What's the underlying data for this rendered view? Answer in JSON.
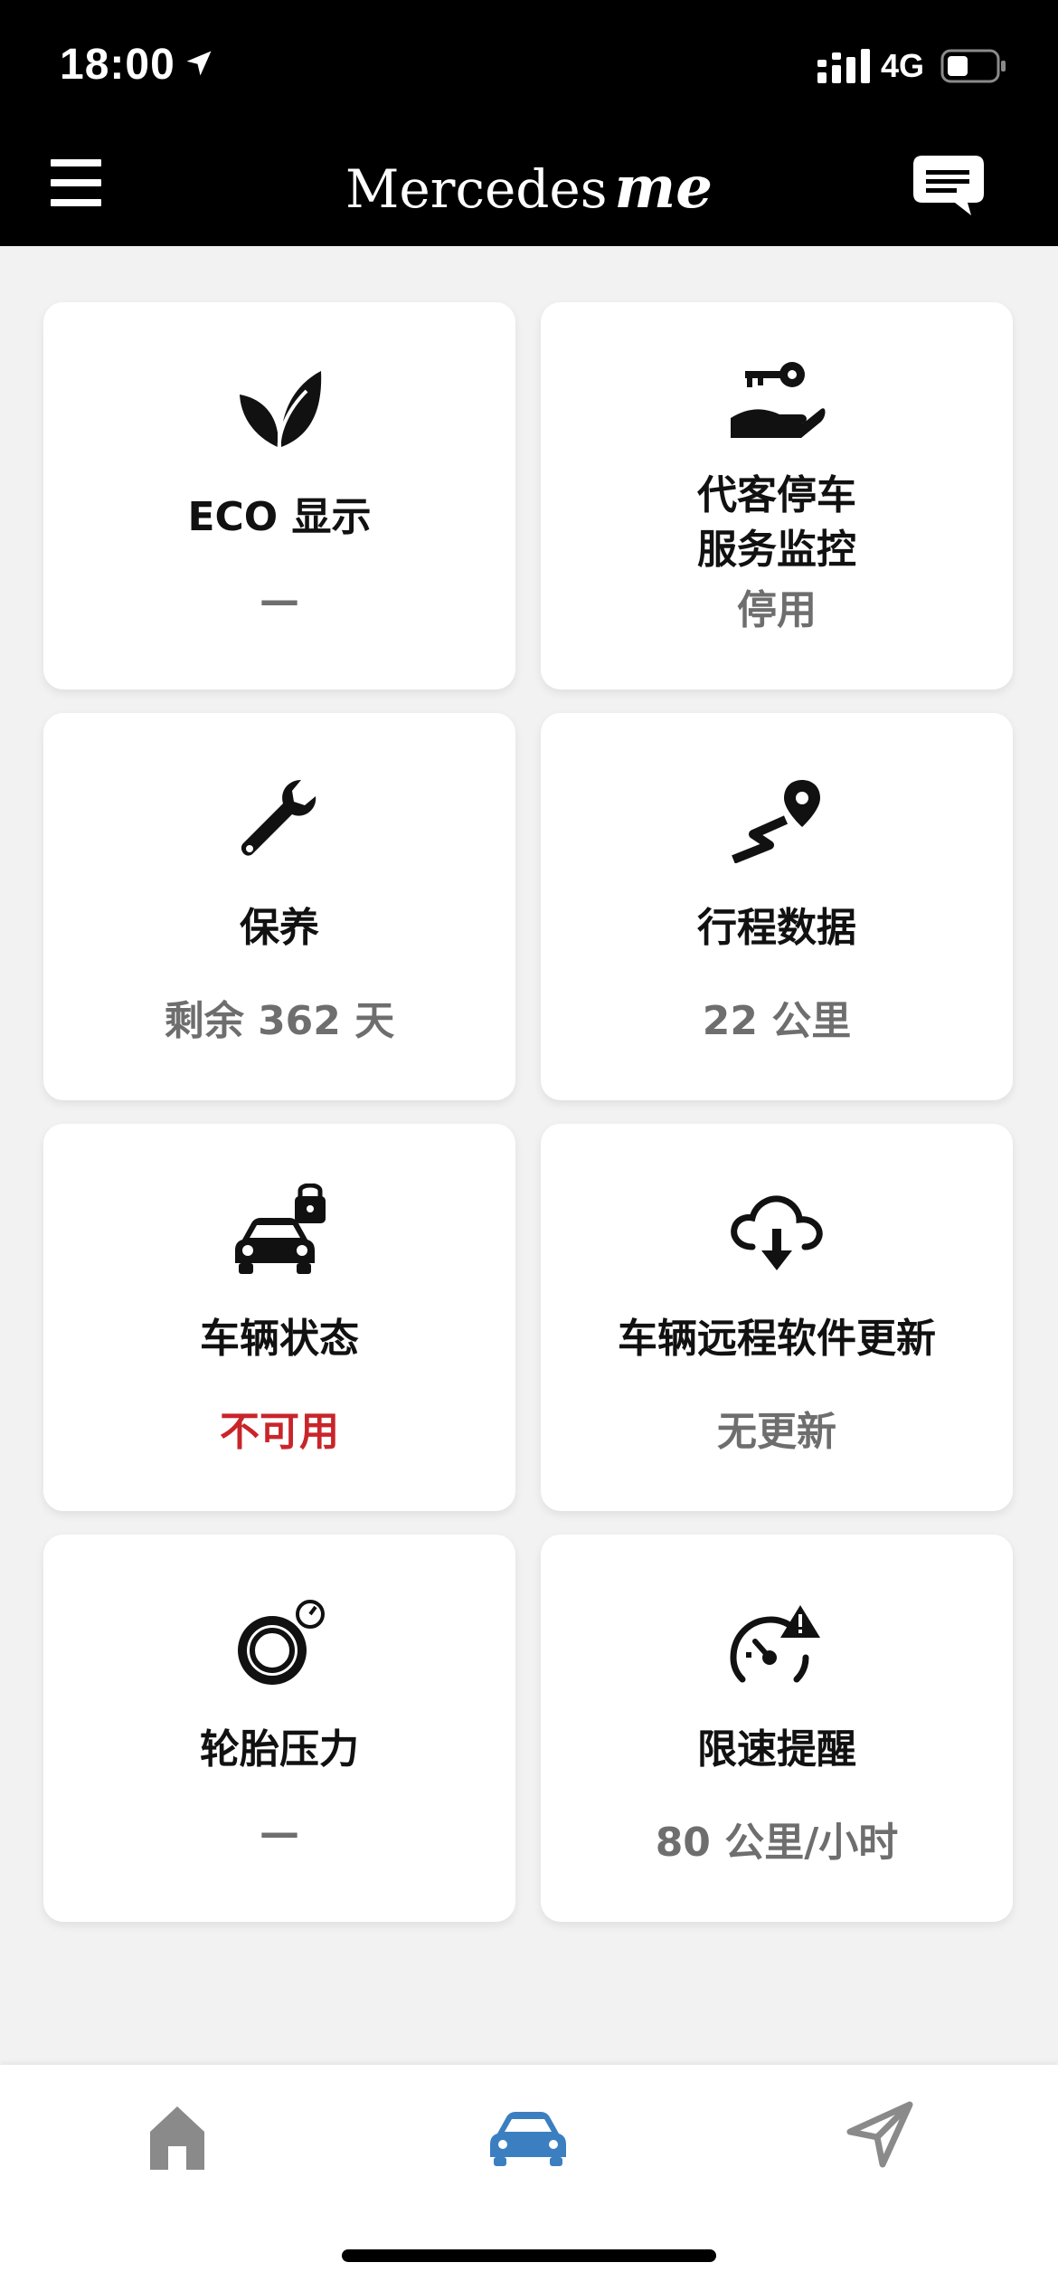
{
  "status_bar": {
    "time": "18:00",
    "network": "4G"
  },
  "header": {
    "brand_main": "Mercedes",
    "brand_me": "me"
  },
  "tiles": [
    {
      "title": "ECO 显示",
      "value": "—",
      "icon": "leaf-icon"
    },
    {
      "title_line1": "代客停车",
      "title_line2": "服务监控",
      "value": "停用",
      "icon": "valet-key-icon"
    },
    {
      "title": "保养",
      "value": "剩余 362 天",
      "icon": "wrench-icon"
    },
    {
      "title": "行程数据",
      "value": "22 公里",
      "icon": "route-icon"
    },
    {
      "title": "车辆状态",
      "value": "不可用",
      "value_color": "#c8252b",
      "icon": "car-lock-icon"
    },
    {
      "title": "车辆远程软件更新",
      "value": "无更新",
      "icon": "cloud-download-icon"
    },
    {
      "title": "轮胎压力",
      "value": "—",
      "icon": "tire-pressure-icon"
    },
    {
      "title": "限速提醒",
      "value": "80 公里/小时",
      "icon": "speed-warning-icon"
    }
  ],
  "bottom_nav": {
    "active": "vehicle",
    "active_color": "#3c7fc0",
    "inactive_color": "#8a8a8a",
    "items": [
      "home-icon",
      "car-icon",
      "navigation-arrow-icon"
    ]
  }
}
